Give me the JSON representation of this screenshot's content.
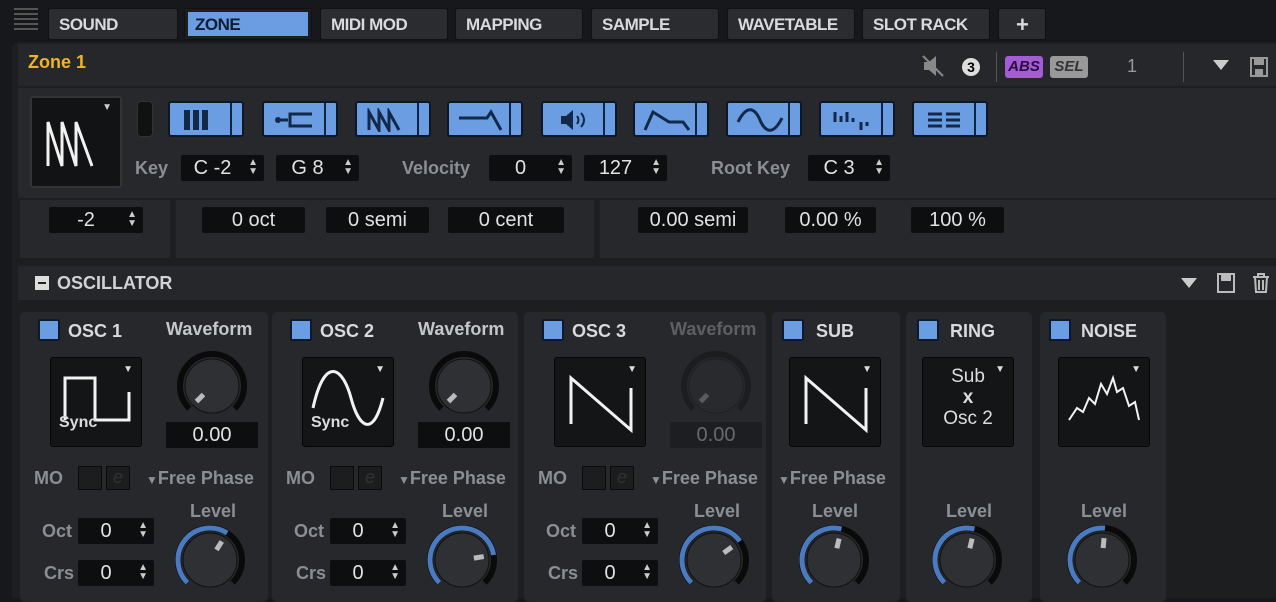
{
  "tabs": [
    {
      "label": "SOUND"
    },
    {
      "label": "ZONE",
      "active": true
    },
    {
      "label": "MIDI MOD"
    },
    {
      "label": "MAPPING"
    },
    {
      "label": "SAMPLE"
    },
    {
      "label": "WAVETABLE"
    },
    {
      "label": "SLOT RACK"
    },
    {
      "label": "+"
    }
  ],
  "zone": {
    "title": "Zone 1",
    "abs": "ABS",
    "sel": "SEL",
    "count": "1",
    "badge": "3"
  },
  "colors": {
    "accent": "#6b9de3",
    "zone_title": "#f0b429",
    "abs": "#a35cd6"
  },
  "editors": [
    "keyboard-icon",
    "pitch-icon",
    "wavetable-icon",
    "filter-icon",
    "amp-icon",
    "envelope-icon",
    "lfo-icon",
    "step-modulator-icon",
    "modulation-matrix-icon"
  ],
  "key": {
    "label": "Key",
    "low": "C -2",
    "high": "G 8"
  },
  "velocity": {
    "label": "Velocity",
    "low": "0",
    "high": "127"
  },
  "root_key": {
    "label": "Root Key",
    "value": "C 3"
  },
  "row3": {
    "a": "-2",
    "oct": "0 oct",
    "semi": "0 semi",
    "cent": "0 cent",
    "semi2": "0.00 semi",
    "pct": "0.00 %",
    "pct2": "100 %"
  },
  "section": {
    "title": "OSCILLATOR"
  },
  "osc": [
    {
      "name": "OSC 1",
      "waveform_label": "Waveform",
      "waveform": "square",
      "sync": "Sync",
      "value": "0.00",
      "mo": "MO",
      "e": "e",
      "phase": "Free Phase",
      "level": "Level",
      "oct_label": "Oct",
      "oct": "0",
      "crs_label": "Crs",
      "crs": "0"
    },
    {
      "name": "OSC 2",
      "waveform_label": "Waveform",
      "waveform": "sine",
      "sync": "Sync",
      "value": "0.00",
      "mo": "MO",
      "e": "e",
      "phase": "Free Phase",
      "level": "Level",
      "oct_label": "Oct",
      "oct": "0",
      "crs_label": "Crs",
      "crs": "0"
    },
    {
      "name": "OSC 3",
      "waveform_label": "Waveform",
      "waveform": "saw",
      "value": "0.00",
      "mo": "MO",
      "e": "e",
      "phase": "Free Phase",
      "level": "Level",
      "oct_label": "Oct",
      "oct": "0",
      "crs_label": "Crs",
      "crs": "0"
    }
  ],
  "sub": {
    "name": "SUB",
    "phase": "Free Phase",
    "level": "Level"
  },
  "ring": {
    "name": "RING",
    "line1": "Sub",
    "line2": "x",
    "line3": "Osc 2",
    "level": "Level"
  },
  "noise": {
    "name": "NOISE",
    "level": "Level"
  }
}
